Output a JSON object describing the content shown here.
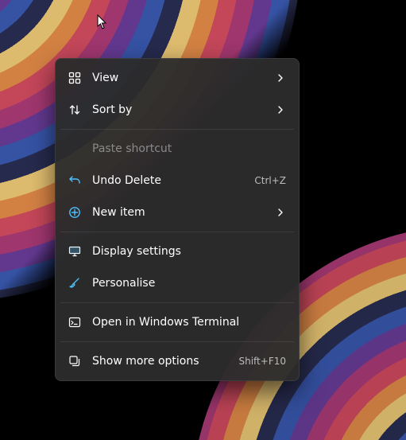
{
  "context_menu": {
    "groups": [
      [
        {
          "id": "view",
          "icon": "grid-icon",
          "label": "View",
          "submenu": true
        },
        {
          "id": "sortby",
          "icon": "sort-icon",
          "label": "Sort by",
          "submenu": true
        }
      ],
      [
        {
          "id": "paste-shortcut",
          "icon": "",
          "label": "Paste shortcut",
          "disabled": true
        },
        {
          "id": "undo",
          "icon": "undo-icon",
          "label": "Undo Delete",
          "shortcut": "Ctrl+Z"
        },
        {
          "id": "newitem",
          "icon": "new-icon",
          "label": "New item",
          "submenu": true
        }
      ],
      [
        {
          "id": "display",
          "icon": "display-icon",
          "label": "Display settings"
        },
        {
          "id": "personal",
          "icon": "brush-icon",
          "label": "Personalise"
        }
      ],
      [
        {
          "id": "terminal",
          "icon": "terminal-icon",
          "label": "Open in Windows Terminal"
        }
      ],
      [
        {
          "id": "more",
          "icon": "more-icon",
          "label": "Show more options",
          "shortcut": "Shift+F10"
        }
      ]
    ]
  },
  "colors": {
    "menu_bg": "#2c2c2c",
    "text": "#ffffff",
    "disabled": "#8a8a8a",
    "shortcut": "#bdbdbd",
    "accent_blue": "#4cc2ff"
  }
}
